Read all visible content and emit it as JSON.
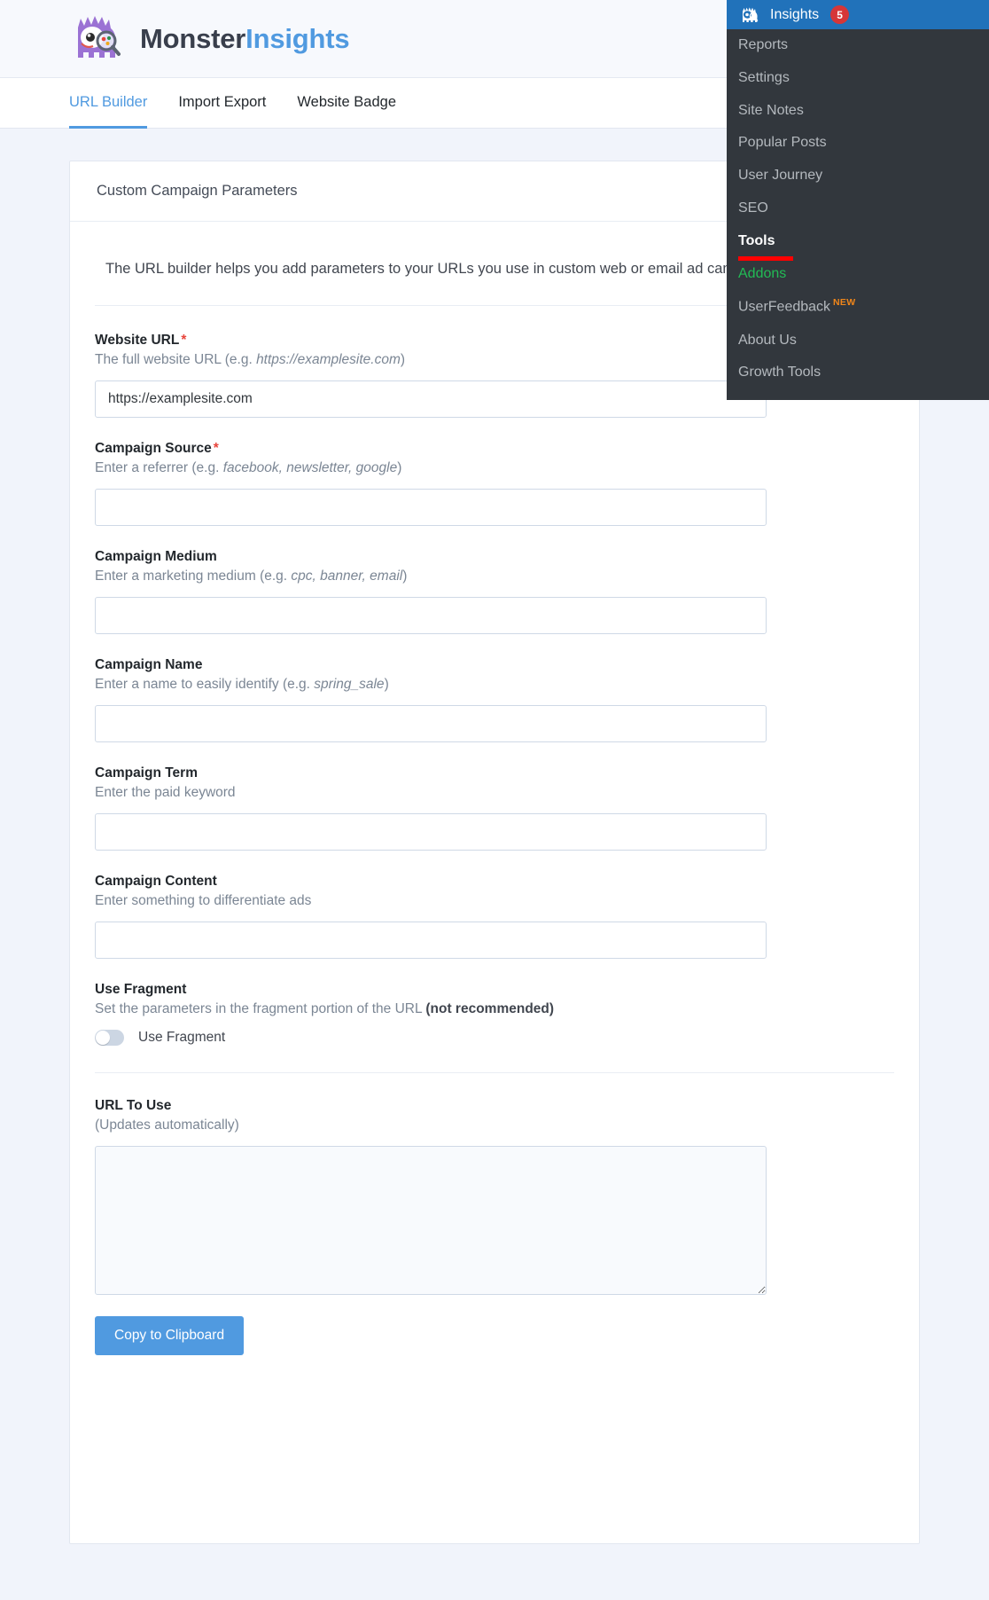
{
  "brand": {
    "name_part1": "Monster",
    "name_part2": "Insights",
    "logo_icon": "monsterinsights-monster-icon",
    "accent_color": "#509ae0",
    "text_color": "#393f4c"
  },
  "tabs": [
    {
      "label": "URL Builder",
      "active": true
    },
    {
      "label": "Import Export",
      "active": false
    },
    {
      "label": "Website Badge",
      "active": false
    }
  ],
  "card": {
    "title": "Custom Campaign Parameters",
    "intro": "The URL builder helps you add parameters to your URLs you use in custom web or email ad campaigns."
  },
  "fields": [
    {
      "label": "Website URL",
      "required": true,
      "desc_prefix": "The full website URL (e.g. ",
      "desc_em": "https://examplesite.com",
      "desc_suffix": ")",
      "value": "https://examplesite.com",
      "placeholder": ""
    },
    {
      "label": "Campaign Source",
      "required": true,
      "desc_prefix": "Enter a referrer (e.g. ",
      "desc_em": "facebook, newsletter, google",
      "desc_suffix": ")",
      "value": "",
      "placeholder": ""
    },
    {
      "label": "Campaign Medium",
      "required": false,
      "desc_prefix": "Enter a marketing medium (e.g. ",
      "desc_em": "cpc, banner, email",
      "desc_suffix": ")",
      "value": "",
      "placeholder": ""
    },
    {
      "label": "Campaign Name",
      "required": false,
      "desc_prefix": "Enter a name to easily identify (e.g. ",
      "desc_em": "spring_sale",
      "desc_suffix": ")",
      "value": "",
      "placeholder": ""
    },
    {
      "label": "Campaign Term",
      "required": false,
      "desc_prefix": "Enter the paid keyword",
      "desc_em": "",
      "desc_suffix": "",
      "value": "",
      "placeholder": ""
    },
    {
      "label": "Campaign Content",
      "required": false,
      "desc_prefix": "Enter something to differentiate ads",
      "desc_em": "",
      "desc_suffix": "",
      "value": "",
      "placeholder": ""
    }
  ],
  "fragment": {
    "label": "Use Fragment",
    "desc_prefix": "Set the parameters in the fragment portion of the URL ",
    "desc_strong": "(not recommended)",
    "toggle_label": "Use Fragment",
    "toggle_on": false
  },
  "url_output": {
    "label": "URL To Use",
    "desc": "(Updates automatically)",
    "value": "",
    "placeholder": "",
    "copy_button": "Copy to Clipboard"
  },
  "admin_menu": {
    "header_label": "Insights",
    "header_icon": "monsterinsights-monster-icon",
    "badge_count": "5",
    "header_bg": "#2172ba",
    "menu_bg": "#32373d",
    "items": [
      {
        "label": "Reports",
        "state": "normal"
      },
      {
        "label": "Settings",
        "state": "normal"
      },
      {
        "label": "Site Notes",
        "state": "normal"
      },
      {
        "label": "Popular Posts",
        "state": "normal"
      },
      {
        "label": "User Journey",
        "state": "normal"
      },
      {
        "label": "SEO",
        "state": "normal"
      },
      {
        "label": "Tools",
        "state": "current"
      },
      {
        "label": "Addons",
        "state": "green"
      },
      {
        "label": "UserFeedback",
        "state": "normal",
        "badge": "NEW"
      },
      {
        "label": "About Us",
        "state": "normal"
      },
      {
        "label": "Growth Tools",
        "state": "normal"
      }
    ],
    "highlight_color": "#ff0000"
  }
}
